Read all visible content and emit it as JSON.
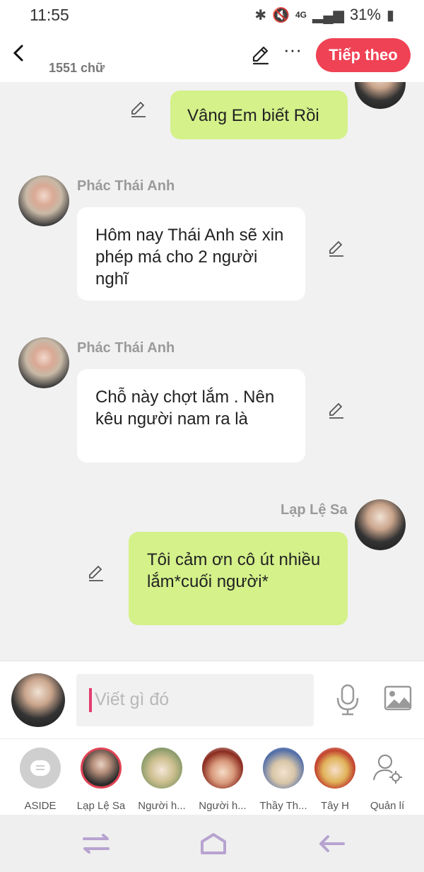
{
  "status_bar": {
    "time": "11:55",
    "network": "4G",
    "battery": "31%",
    "icons": [
      "bluetooth-icon",
      "mute-icon",
      "signal-icon",
      "battery-icon"
    ]
  },
  "top_bar": {
    "word_count": "1551 chữ",
    "next_label": "Tiếp theo",
    "accent_color": "#ef4254"
  },
  "messages": [
    {
      "side": "right",
      "text": "Vâng Em biết Rồi",
      "sender": ""
    },
    {
      "side": "left",
      "sender": "Phác Thái Anh",
      "text": "Hôm nay Thái Anh sẽ xin phép má cho 2 người nghĩ"
    },
    {
      "side": "left",
      "sender": "Phác Thái Anh",
      "text": "Chỗ này chợt lắm . Nên kêu người nam ra là"
    },
    {
      "side": "right",
      "sender": "Lạp Lệ Sa",
      "text": "Tôi cảm ơn cô út nhiều lắm*cuối người*"
    }
  ],
  "input": {
    "placeholder": "Viết gì đó"
  },
  "characters": [
    {
      "name": "ASIDE"
    },
    {
      "name": "Lạp Lệ Sa"
    },
    {
      "name": "Người h..."
    },
    {
      "name": "Người h..."
    },
    {
      "name": "Thầy Th..."
    },
    {
      "name": "Tây H"
    },
    {
      "name": "Quản lí"
    }
  ],
  "colors": {
    "bubble_self": "#d4f18a",
    "bubble_other": "#ffffff",
    "nav_icon": "#b7a3d0"
  }
}
